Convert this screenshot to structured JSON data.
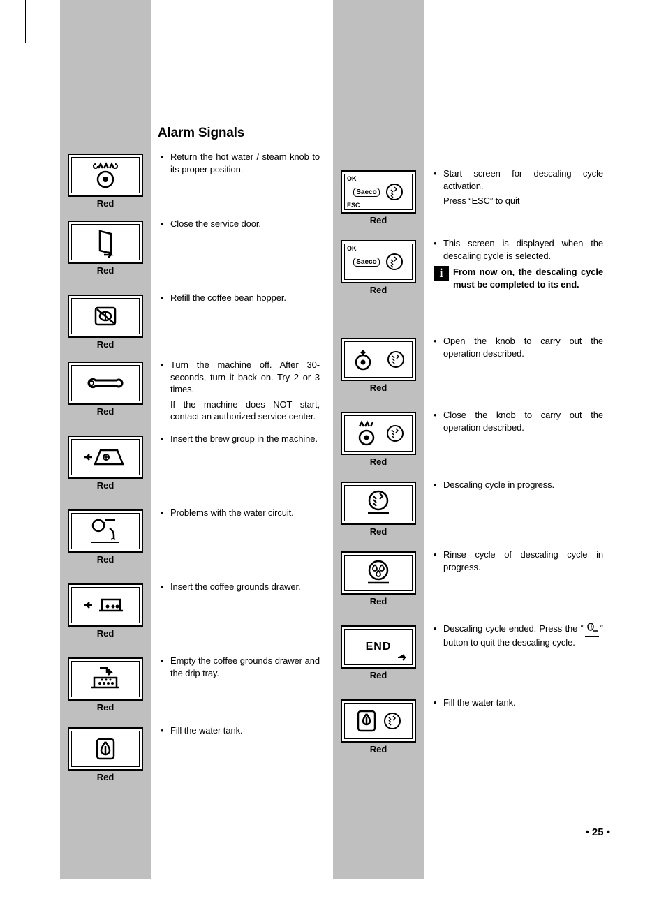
{
  "section_title": "Alarm Signals",
  "red_label": "Red",
  "page_number": "• 25 •",
  "left": [
    {
      "text": "Return the hot water / steam knob to its proper position."
    },
    {
      "text": "Close the service door."
    },
    {
      "text": "Refill the coffee bean hopper."
    },
    {
      "text": "Turn the machine off. After 30-seconds, turn it back on. Try 2 or 3 times.",
      "extra": "If the machine does NOT start, contact an authorized service center."
    },
    {
      "text": "Insert the brew group in the machine."
    },
    {
      "text": "Problems with the water circuit."
    },
    {
      "text": "Insert the coffee grounds drawer."
    },
    {
      "text": "Empty the coffee grounds drawer and the drip tray."
    },
    {
      "text": "Fill the water tank."
    }
  ],
  "right": [
    {
      "text": "Start screen for descaling cycle activation.",
      "extra": "Press “ESC” to quit"
    },
    {
      "text": "This screen is displayed when the descaling cycle is selected.",
      "note": "From now on, the descaling cycle must be completed to its end."
    },
    {
      "text": "Open the knob to carry out the operation described."
    },
    {
      "text": "Close the knob to carry out the operation described."
    },
    {
      "text": "Descaling cycle in progress."
    },
    {
      "text": "Rinse cycle of descaling cycle in progress."
    },
    {
      "text_pre": "Descaling cycle ended. Press the “",
      "text_post": "“ button to quit the descaling cycle.",
      "has_inline_icon": true
    },
    {
      "text": "Fill the water tank."
    }
  ],
  "lcd_text": {
    "ok": "OK",
    "esc": "ESC",
    "saeco": "Saeco",
    "end": "END"
  }
}
